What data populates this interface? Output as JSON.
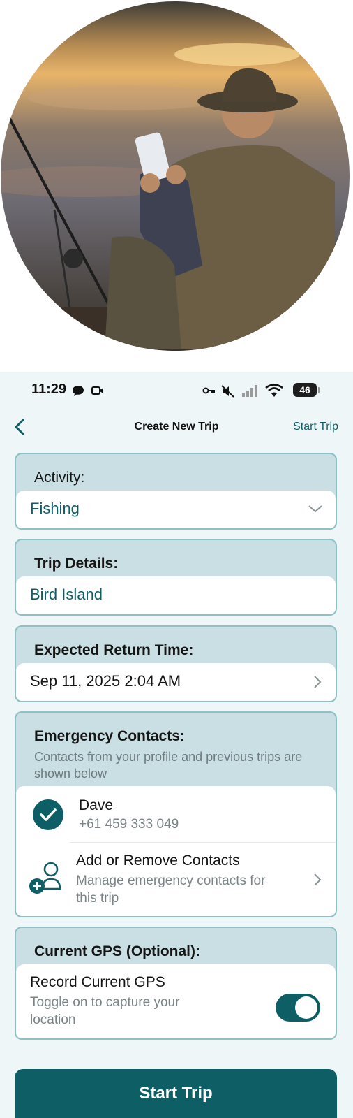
{
  "hero": {
    "image": "fisherman-checking-phone-at-lakeside-sunset"
  },
  "status_bar": {
    "time": "11:29",
    "battery": "46"
  },
  "nav": {
    "title": "Create New Trip",
    "action": "Start Trip"
  },
  "activity": {
    "label": "Activity:",
    "value": "Fishing"
  },
  "trip_details": {
    "label": "Trip Details:",
    "value": "Bird Island"
  },
  "return_time": {
    "label": "Expected Return Time:",
    "value": "Sep 11, 2025 2:04 AM"
  },
  "contacts": {
    "label": "Emergency Contacts:",
    "subtitle": "Contacts from your profile and previous trips are shown below",
    "items": [
      {
        "name": "Dave",
        "phone": "+61 459 333 049",
        "selected": true
      }
    ],
    "manage": {
      "title": "Add or Remove Contacts",
      "subtitle": "Manage emergency contacts for this trip"
    }
  },
  "gps": {
    "label": "Current GPS (Optional):",
    "row_title": "Record Current GPS",
    "row_subtitle": "Toggle on to capture your location",
    "enabled": true
  },
  "primary_button": "Start Trip",
  "colors": {
    "accent": "#0e5e66",
    "card_bg": "#c9dfe3",
    "card_border": "#8ec0c6",
    "page_bg": "#eef6f8"
  }
}
